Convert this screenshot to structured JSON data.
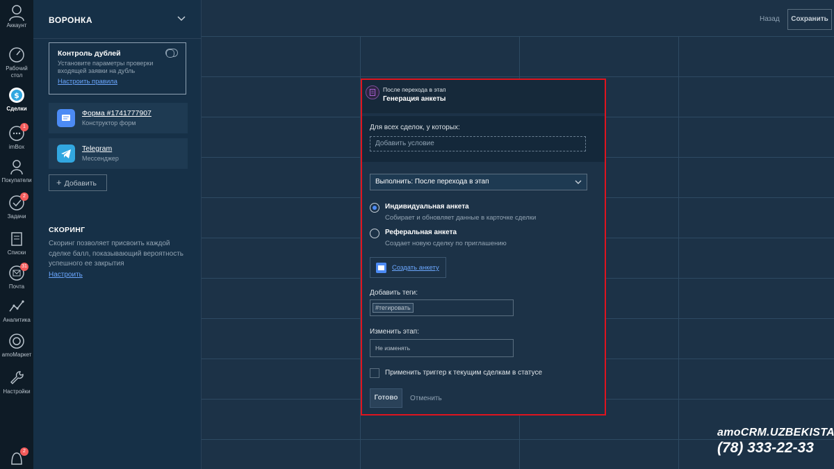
{
  "nav": {
    "items": [
      {
        "label": "Аккаунт",
        "icon": "user-icon"
      },
      {
        "label": "Рабочий стол",
        "icon": "speedometer-icon"
      },
      {
        "label": "Сделки",
        "icon": "dollar-icon"
      },
      {
        "label": "imBox",
        "icon": "chat-icon",
        "badge": "1"
      },
      {
        "label": "Покупатели",
        "icon": "person-icon"
      },
      {
        "label": "Задачи",
        "icon": "checkmark-icon",
        "badge": "2"
      },
      {
        "label": "Списки",
        "icon": "notebook-icon"
      },
      {
        "label": "Почта",
        "icon": "mail-icon",
        "badge": "31"
      },
      {
        "label": "Аналитика",
        "icon": "analytics-icon"
      },
      {
        "label": "amoМаркет",
        "icon": "market-icon"
      },
      {
        "label": "Настройки",
        "icon": "wrench-icon"
      }
    ],
    "bottom_badge": "2"
  },
  "panel": {
    "title": "ВОРОНКА",
    "duplicates": {
      "title": "Контроль дублей",
      "description": "Установите параметры проверки входящей заявки на дубль",
      "link": "Настроить правила"
    },
    "sources": [
      {
        "name": "Форма #1741777907",
        "sub": "Конструктор форм",
        "icon": "form-icon",
        "color": "#4c8bf5"
      },
      {
        "name": "Telegram",
        "sub": "Мессенджер",
        "icon": "telegram-icon",
        "color": "#32a7e0"
      }
    ],
    "add_label": "Добавить",
    "scoring": {
      "title": "СКОРИНГ",
      "description": "Скоринг позволяет присвоить каждой сделке балл, показывающий вероятность успешного ее закрытия",
      "link": "Настроить"
    }
  },
  "topbar": {
    "back": "Назад",
    "save": "Сохранить"
  },
  "trigger": {
    "header_sub": "После перехода в этап",
    "header_title": "Генерация анкеты",
    "conditions_label": "Для всех сделок, у которых:",
    "conditions_placeholder": "Добавить условие",
    "execute_value": "Выполнить: После перехода в этап",
    "options": [
      {
        "title": "Индивидуальная анкета",
        "sub": "Собирает и обновляет данные в карточке сделки",
        "checked": true
      },
      {
        "title": "Реферальная анкета",
        "sub": "Создает новую сделку по приглашению",
        "checked": false
      }
    ],
    "create_label": "Создать анкету",
    "tags_label": "Добавить теги:",
    "tags_chip": "#тегировать",
    "stage_label": "Изменить этап:",
    "stage_value": "Не изменять",
    "apply_label": "Применить триггер к текущим сделкам в статусе",
    "done": "Готово",
    "cancel": "Отменить"
  },
  "watermark": {
    "brand": "amoCRM.UZBEKISTAN",
    "phone": "(78) 333-22-33"
  },
  "colors": {
    "accent": "#4c8bf5",
    "highlight_border": "#e0141e",
    "badge": "#f35b5b"
  }
}
